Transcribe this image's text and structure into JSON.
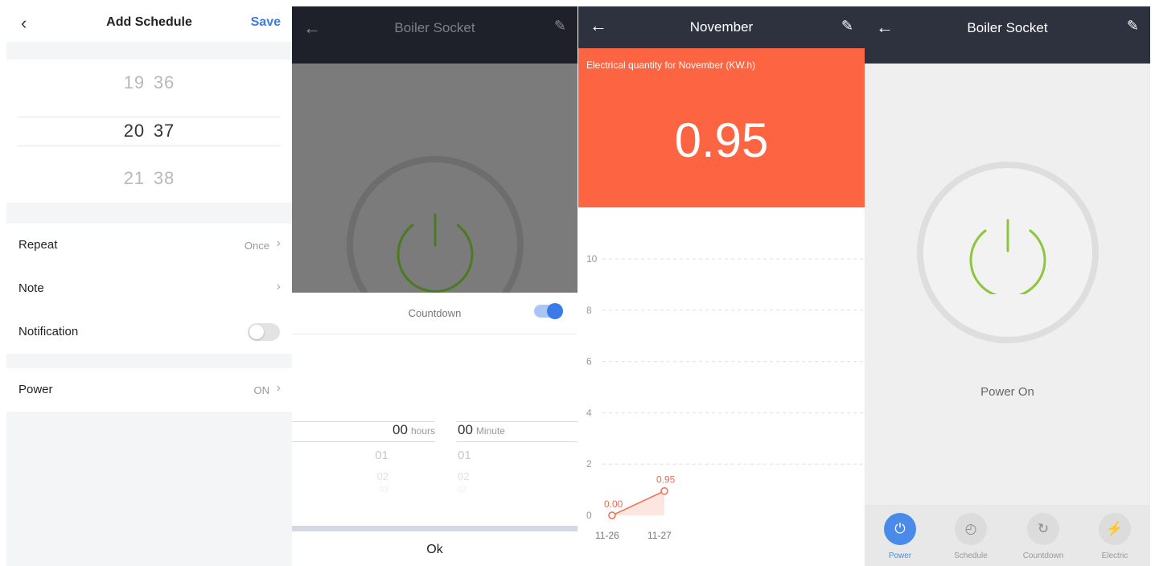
{
  "schedule": {
    "title": "Add Schedule",
    "save_label": "Save",
    "back_icon": "chevron-left-icon",
    "time_picker": {
      "prev": {
        "hour": "19",
        "minute": "36"
      },
      "selected": {
        "hour": "20",
        "minute": "37"
      },
      "next": {
        "hour": "21",
        "minute": "38"
      }
    },
    "repeat": {
      "label": "Repeat",
      "value": "Once"
    },
    "note": {
      "label": "Note"
    },
    "notification": {
      "label": "Notification",
      "enabled": false
    },
    "power": {
      "label": "Power",
      "value": "ON"
    },
    "accent_color": "#3a7be8"
  },
  "countdown": {
    "title": "Boiler Socket",
    "label": "Countdown",
    "enabled": true,
    "hours": {
      "selected": "00",
      "unit": "hours",
      "options": [
        "01",
        "02",
        "03"
      ]
    },
    "minutes": {
      "selected": "00",
      "unit": "Minute",
      "options": [
        "01",
        "02",
        "03"
      ]
    },
    "ok_label": "Ok",
    "power_color": "#5a8a2a"
  },
  "electric": {
    "title": "November",
    "caption": "Electrical quantity for November (KW.h)",
    "total": "0.95",
    "banner_color": "#fd6442",
    "chart_data": {
      "type": "line",
      "x": [
        "11-26",
        "11-27"
      ],
      "y_ticks": [
        "0",
        "2",
        "4",
        "6",
        "8",
        "10"
      ],
      "series": [
        {
          "values": [
            0.0,
            0.95
          ],
          "labels": [
            "0.00",
            "0.95"
          ],
          "color": "#f26b50"
        }
      ],
      "ylim": [
        0,
        10
      ],
      "grid": true
    }
  },
  "socket": {
    "title": "Boiler Socket",
    "status": "Power On",
    "power_color": "#8cc63f",
    "nav": [
      {
        "label": "Power",
        "icon": "power-icon",
        "active": true
      },
      {
        "label": "Schedule",
        "icon": "clock-icon",
        "active": false
      },
      {
        "label": "Countdown",
        "icon": "timer-icon",
        "active": false
      },
      {
        "label": "Electric",
        "icon": "lightning-icon",
        "active": false
      }
    ],
    "accent_color": "#4a8bea"
  }
}
